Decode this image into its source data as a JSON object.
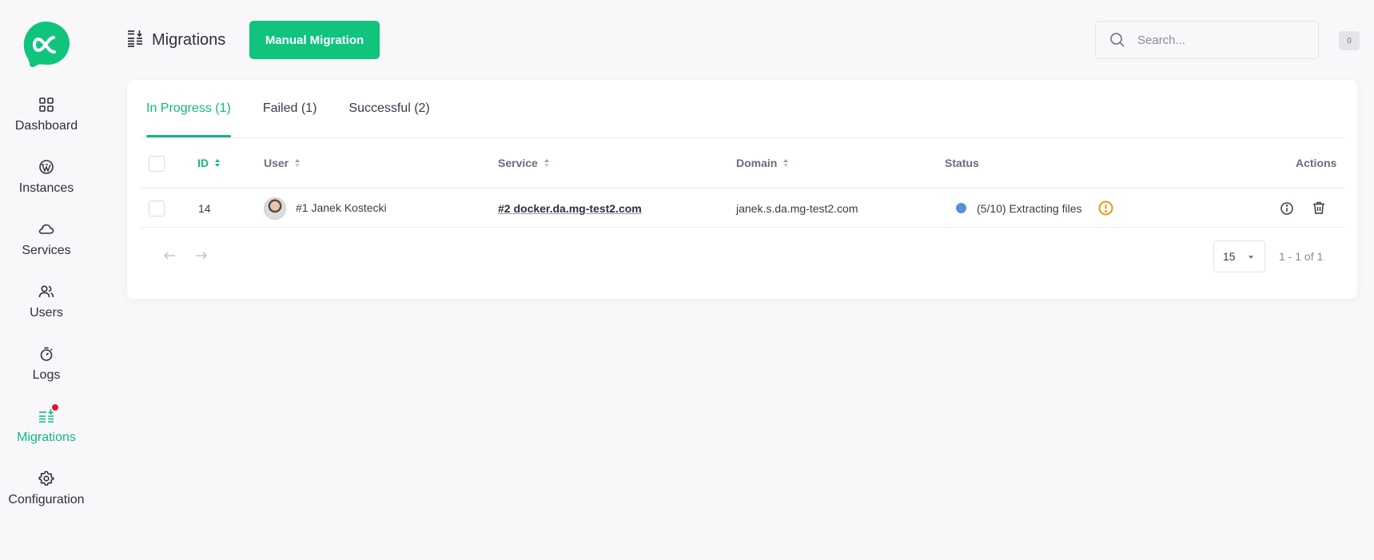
{
  "sidebar": {
    "items": [
      {
        "label": "Dashboard",
        "icon": "grid-icon"
      },
      {
        "label": "Instances",
        "icon": "wordpress-icon"
      },
      {
        "label": "Services",
        "icon": "cloud-icon"
      },
      {
        "label": "Users",
        "icon": "users-icon"
      },
      {
        "label": "Logs",
        "icon": "timer-icon"
      },
      {
        "label": "Migrations",
        "icon": "migrations-icon",
        "active": true
      },
      {
        "label": "Configuration",
        "icon": "gear-icon"
      }
    ]
  },
  "header": {
    "title": "Migrations",
    "manual_button": "Manual Migration",
    "search_placeholder": "Search...",
    "counter": "0"
  },
  "tabs": [
    {
      "label": "In Progress (1)",
      "active": true
    },
    {
      "label": "Failed (1)"
    },
    {
      "label": "Successful (2)"
    }
  ],
  "table": {
    "columns": {
      "id": "ID",
      "user": "User",
      "service": "Service",
      "domain": "Domain",
      "status": "Status",
      "actions": "Actions"
    },
    "rows": [
      {
        "id": "14",
        "user": "#1 Janek Kostecki",
        "service": "#2 docker.da.mg-test2.com",
        "domain": "janek.s.da.mg-test2.com",
        "status": "(5/10) Extracting files"
      }
    ]
  },
  "pagination": {
    "per_page": "15",
    "range": "1 - 1 of 1"
  },
  "colors": {
    "accent": "#10b981",
    "status_dot": "#5b8fd6",
    "warning": "#f08c00",
    "notification": "#e0142a"
  }
}
